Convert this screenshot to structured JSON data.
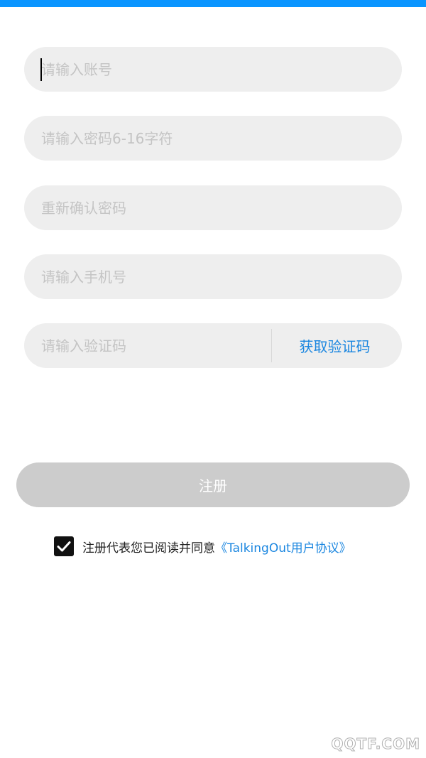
{
  "colors": {
    "top_bar": "#0a95ff",
    "field_bg": "#eeeeee",
    "placeholder": "#c4c4c4",
    "link": "#1a86e0",
    "button_disabled": "#cccccc"
  },
  "form": {
    "account": {
      "value": "",
      "placeholder": "请输入账号"
    },
    "password": {
      "value": "",
      "placeholder": "请输入密码6-16字符"
    },
    "confirm_password": {
      "value": "",
      "placeholder": "重新确认密码"
    },
    "phone": {
      "value": "",
      "placeholder": "请输入手机号"
    },
    "verification_code": {
      "value": "",
      "placeholder": "请输入验证码"
    },
    "get_code_label": "获取验证码"
  },
  "register_button": {
    "label": "注册"
  },
  "agreement": {
    "checked": true,
    "checkbox_icon": "check-icon",
    "text": "注册代表您已阅读并同意",
    "link_text": "《TalkingOut用户协议》"
  },
  "watermark": {
    "text": "QQTF.COM"
  }
}
